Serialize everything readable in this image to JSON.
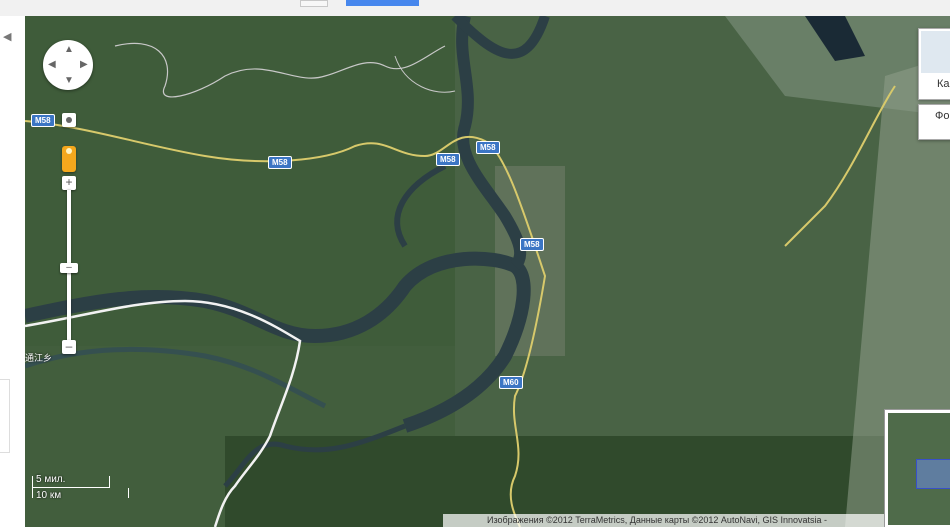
{
  "map": {
    "road_labels": [
      "M58",
      "M58",
      "M58",
      "M58",
      "M58",
      "M60"
    ],
    "place_label": "通江乡",
    "scale": {
      "imperial": "5 мил.",
      "metric": "10 км"
    },
    "attribution": "Изображения ©2012 TerraMetrics, Данные карты ©2012 AutoNavi, GIS Innovatsia -",
    "map_type": {
      "map_label": "Ка",
      "photo_label": "Фо"
    },
    "colors": {
      "forest": "#3f5c3a",
      "river": "#2c3f45",
      "road": "#d7c96b",
      "highway": "#f2f2f2"
    }
  }
}
